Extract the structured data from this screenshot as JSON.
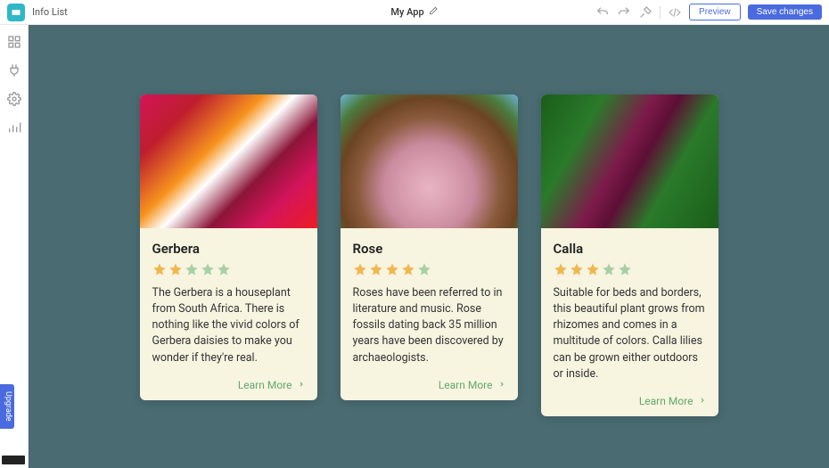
{
  "topbar": {
    "page_title": "Info List",
    "app_title": "My App",
    "preview_label": "Preview",
    "save_label": "Save changes"
  },
  "upgrade_label": "Upgrade",
  "colors": {
    "canvas_bg": "#4a6b72",
    "card_bg": "#f7f4e0",
    "star_filled": "#f0b74e",
    "star_empty": "#a8cfa5",
    "accent_link": "#64a96d",
    "primary": "#4a6bdf"
  },
  "cards": [
    {
      "title": "Gerbera",
      "rating": 2,
      "description": "The Gerbera is a houseplant from South Africa. There is nothing like the vivid colors of Gerbera daisies to make you wonder if they're real.",
      "link_label": "Learn More",
      "img_class": "img-gerbera"
    },
    {
      "title": "Rose",
      "rating": 4,
      "description": "Roses have been referred to in literature and music. Rose fossils dating back 35 million years have been discovered by archaeologists.",
      "link_label": "Learn More",
      "img_class": "img-rose"
    },
    {
      "title": "Calla",
      "rating": 3,
      "description": "Suitable for beds and borders, this beautiful plant grows from rhizomes and comes in a multitude of colors. Calla lilies can be grown either outdoors or inside.",
      "link_label": "Learn More",
      "img_class": "img-calla"
    }
  ]
}
